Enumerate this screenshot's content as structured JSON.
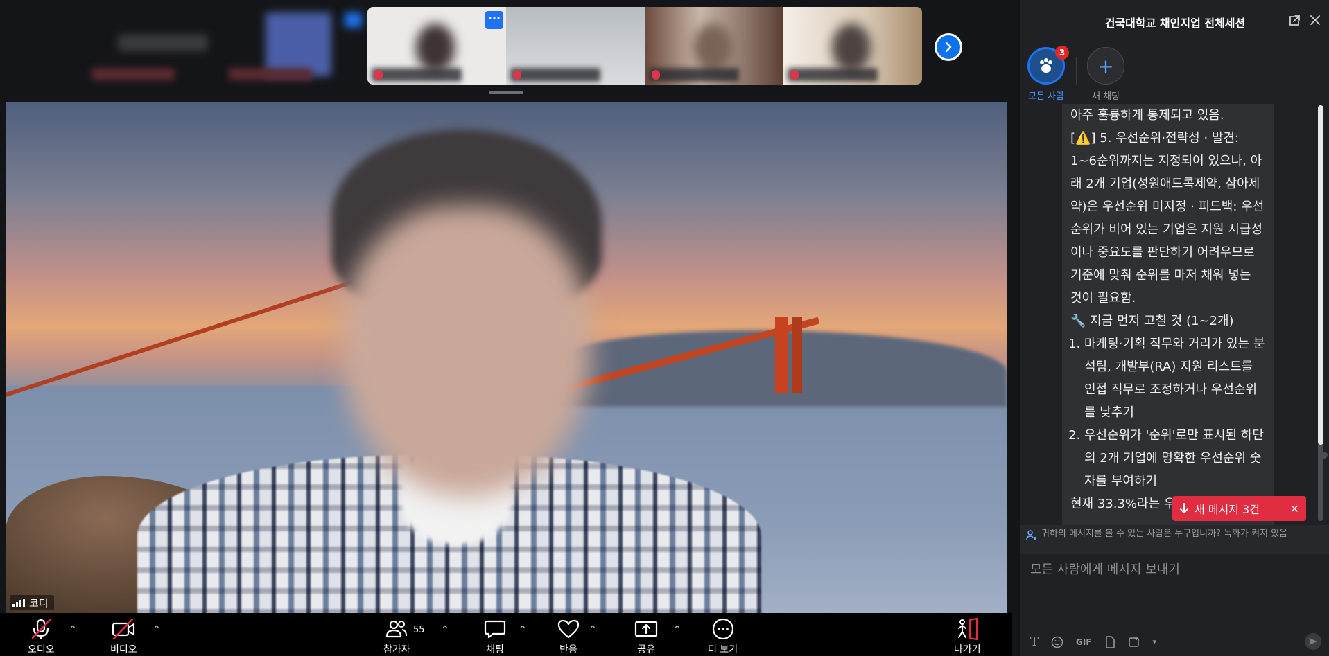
{
  "meeting": {
    "speaker_name": "코디",
    "thumb_more": "···",
    "next_icon": "chevron-right-icon"
  },
  "toolbar": {
    "audio": "오디오",
    "video": "비디오",
    "participants": "참가자",
    "participants_count": "55",
    "chat": "채팅",
    "reactions": "반응",
    "share": "공유",
    "more": "더 보기",
    "leave": "나가기"
  },
  "chat": {
    "title": "건국대학교 채인지업 전체세션",
    "rooms": {
      "all_label": "모든 사람",
      "all_badge": "3",
      "new_label": "새 채팅",
      "new_symbol": "+"
    },
    "message": {
      "line0": "아주 훌륭하게 통제되고 있음.",
      "warn_prefix": "[",
      "warn_icon": "⚠️",
      "warn_text": "] 5. 우선순위·전략성 · 발견: 1~6순위까지는 지정되어 있으나, 아래 2개 기업(성원애드콕제약, 삼아제약)은 우선순위 미지정 · 피드백: 우선순위가 비어 있는 기업은 지원 시급성이나 중요도를 판단하기 어려우므로 기준에 맞춰 순위를 마저 채워 넣는 것이 필요함.",
      "fix_icon": "🔧",
      "fix_heading": " 지금 먼저 고칠 것 (1~2개)",
      "items": [
        "마케팅·기획 직무와 거리가 있는 분석팀, 개발부(RA) 지원 리스트를 인접 직무로 조정하거나 우선순위를 낮추기",
        "우선순위가 '순위'로만 표시된 하단의 2개 기업에 명확한 우선순위 숫자를 부여하기"
      ],
      "tail": "현재 33.3%라는 우선 ..."
    },
    "new_messages": "새 메시지 3건",
    "privacy_notice": "귀하의 메시지를 볼 수 있는 사람은 누구입니까? 녹화가 켜져 있음",
    "input_placeholder": "모든 사람에게 메시지 보내기",
    "tools": {
      "gif": "GIF"
    }
  },
  "colors": {
    "accent": "#0e72ed",
    "danger": "#e02d41",
    "panel": "#1f2124"
  }
}
